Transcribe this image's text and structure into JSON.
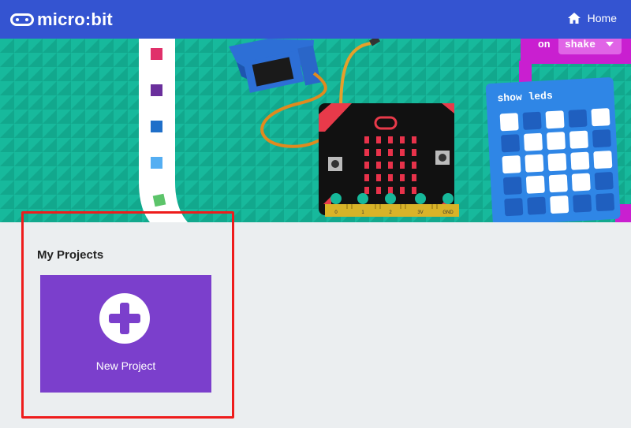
{
  "header": {
    "brand": "micro:bit",
    "home_label": "Home",
    "colors": {
      "bar": "#3454d1"
    }
  },
  "hero": {
    "event_block": {
      "on": "on",
      "event": "shake"
    },
    "show_leds_block": {
      "label": "show leds",
      "grid": [
        [
          1,
          0,
          1,
          0,
          1
        ],
        [
          0,
          1,
          1,
          1,
          0
        ],
        [
          1,
          1,
          1,
          1,
          1
        ],
        [
          0,
          1,
          1,
          1,
          0
        ],
        [
          0,
          0,
          1,
          0,
          0
        ]
      ]
    },
    "board_pins": [
      "0",
      "1",
      "2",
      "3V",
      "GND"
    ],
    "palette_colors": [
      "#e0306a",
      "#6a2f9c",
      "#1f6fc9",
      "#54aef2",
      "#5cc46a"
    ]
  },
  "projects": {
    "title": "My Projects",
    "new_project_label": "New Project",
    "icon": "plus-icon"
  }
}
